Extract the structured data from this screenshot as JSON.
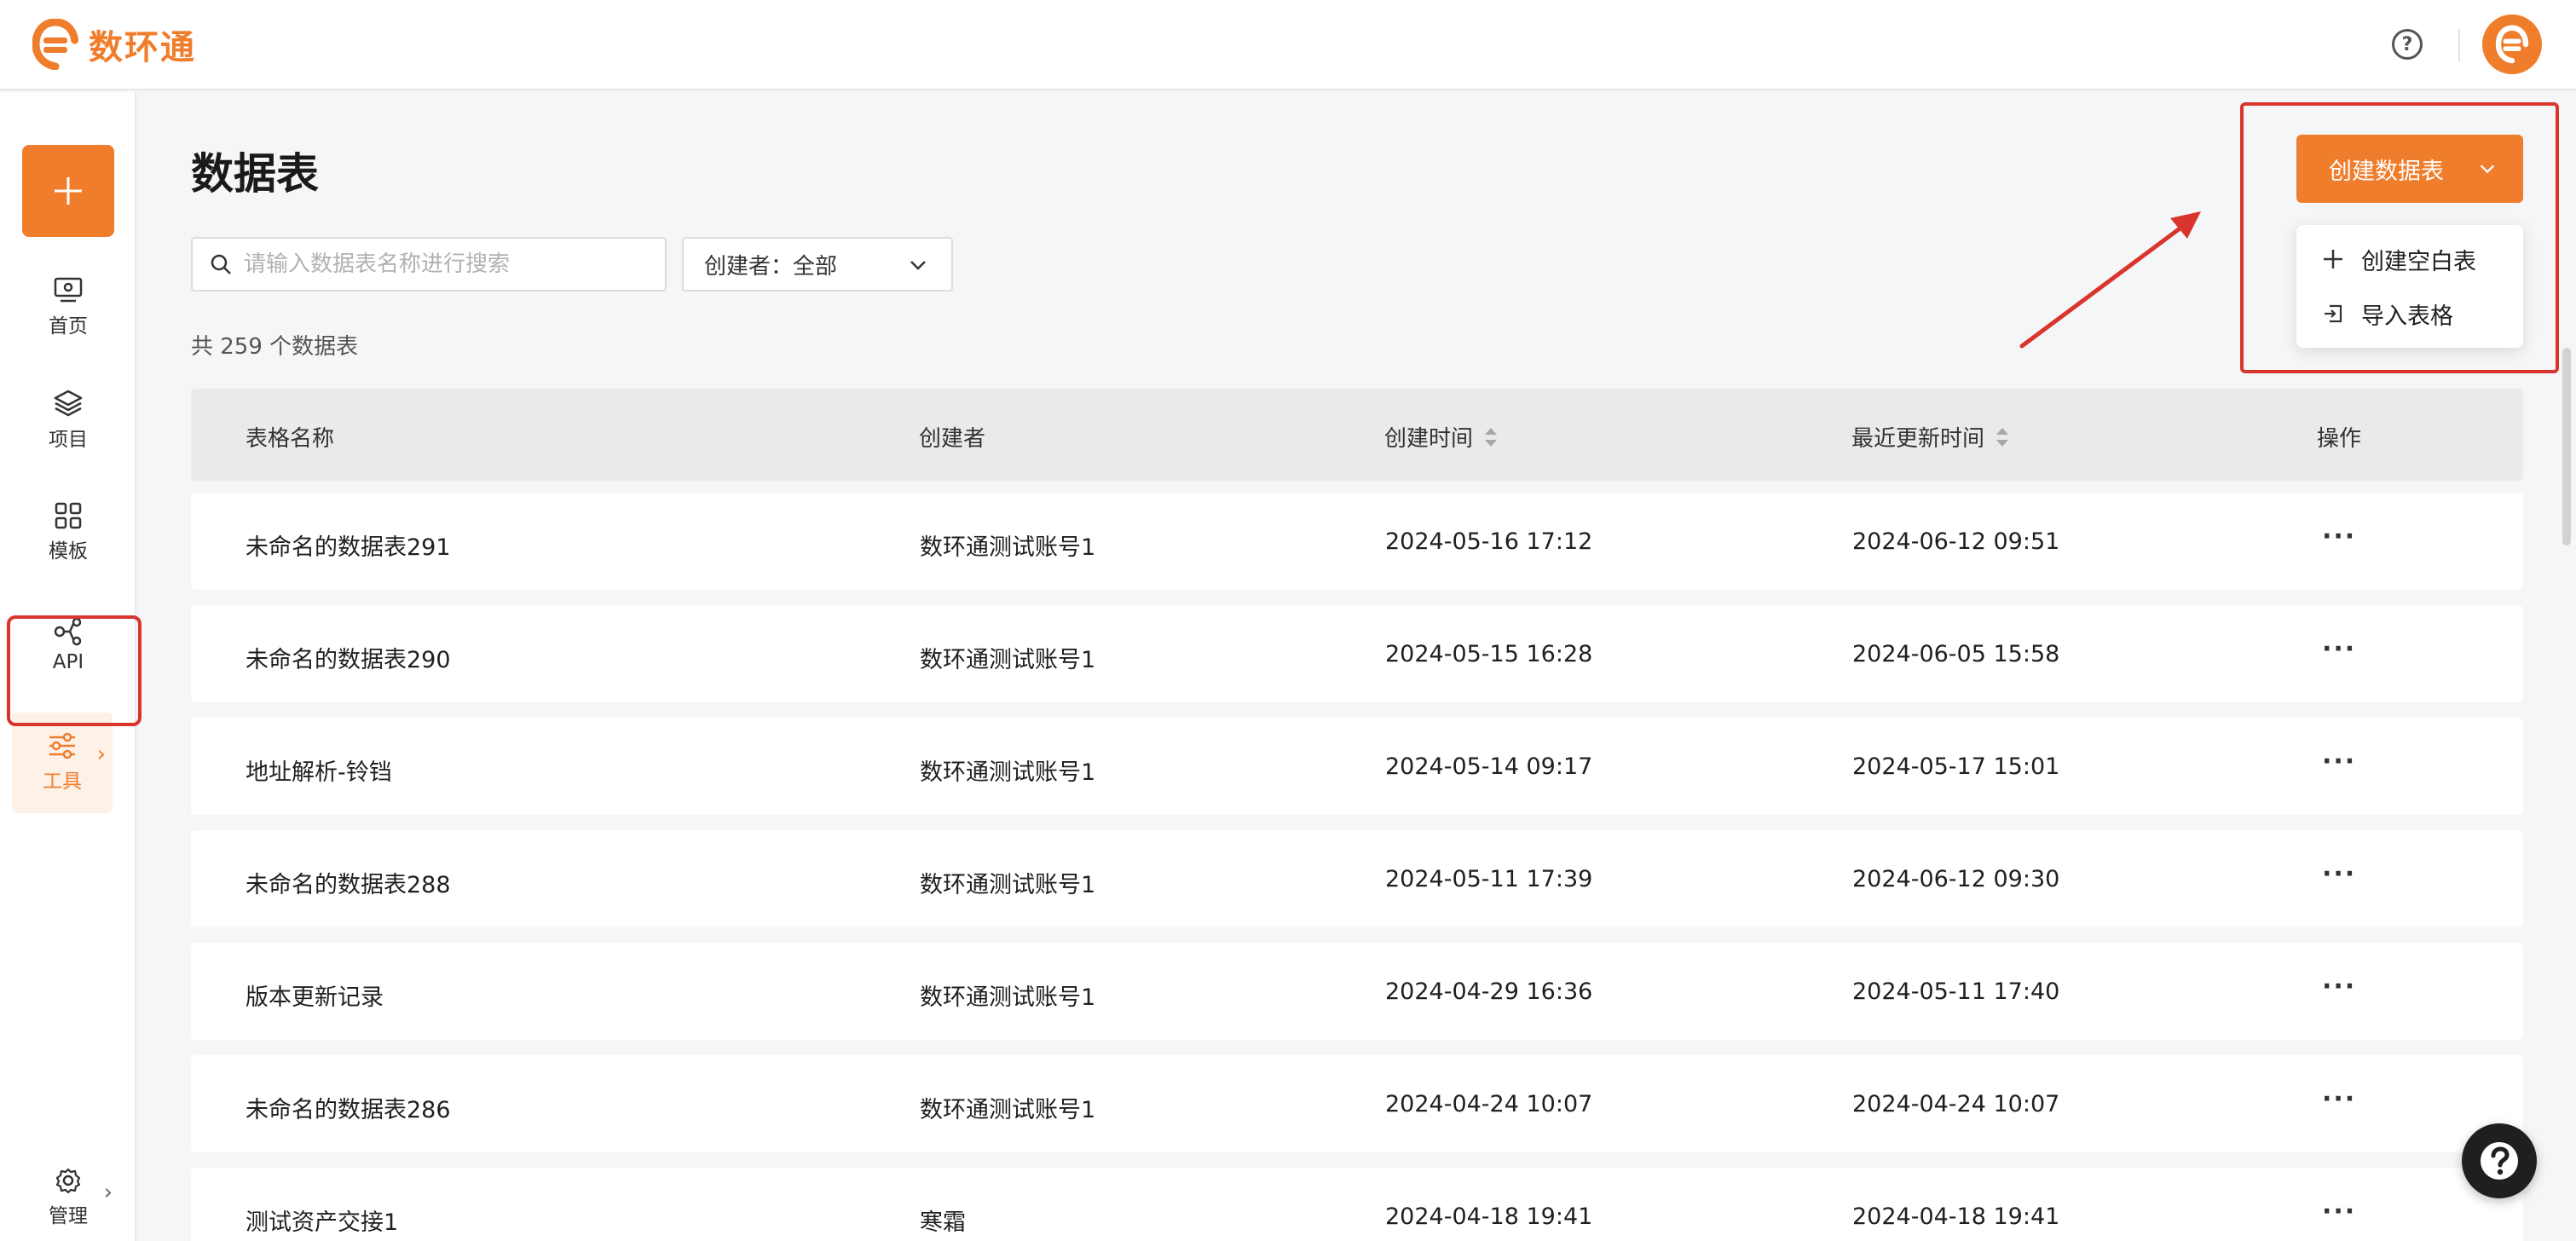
{
  "app": {
    "brand": "数环通"
  },
  "sidebar": {
    "items": [
      {
        "label": "首页"
      },
      {
        "label": "项目"
      },
      {
        "label": "模板"
      },
      {
        "label": "API"
      },
      {
        "label": "工具"
      },
      {
        "label": "管理"
      }
    ]
  },
  "main": {
    "title": "数据表",
    "search_placeholder": "请输入数据表名称进行搜索",
    "creator_filter": "创建者：全部",
    "total": "共 259 个数据表",
    "create_button": "创建数据表",
    "create_menu": [
      "创建空白表",
      "导入表格"
    ]
  },
  "table": {
    "columns": [
      "表格名称",
      "创建者",
      "创建时间",
      "最近更新时间",
      "操作"
    ],
    "rows": [
      {
        "name": "未命名的数据表291",
        "creator": "数环通测试账号1",
        "created": "2024-05-16 17:12",
        "updated": "2024-06-12 09:51"
      },
      {
        "name": "未命名的数据表290",
        "creator": "数环通测试账号1",
        "created": "2024-05-15 16:28",
        "updated": "2024-06-05 15:58"
      },
      {
        "name": "地址解析-铃铛",
        "creator": "数环通测试账号1",
        "created": "2024-05-14 09:17",
        "updated": "2024-05-17 15:01"
      },
      {
        "name": "未命名的数据表288",
        "creator": "数环通测试账号1",
        "created": "2024-05-11 17:39",
        "updated": "2024-06-12 09:30"
      },
      {
        "name": "版本更新记录",
        "creator": "数环通测试账号1",
        "created": "2024-04-29 16:36",
        "updated": "2024-05-11 17:40"
      },
      {
        "name": "未命名的数据表286",
        "creator": "数环通测试账号1",
        "created": "2024-04-24 10:07",
        "updated": "2024-04-24 10:07"
      },
      {
        "name": "测试资产交接1",
        "creator": "寒霜",
        "created": "2024-04-18 19:41",
        "updated": "2024-04-18 19:41"
      }
    ]
  },
  "colors": {
    "accent": "#f07d2c",
    "annotation": "#d9352d"
  },
  "icons": [
    "logo-icon",
    "help-icon",
    "avatar-icon",
    "plus-icon",
    "home-icon",
    "layers-icon",
    "grid-icon",
    "api-icon",
    "sliders-icon",
    "gear-icon",
    "search-icon",
    "chevron-down-icon",
    "sort-icon",
    "more-icon",
    "import-icon"
  ]
}
